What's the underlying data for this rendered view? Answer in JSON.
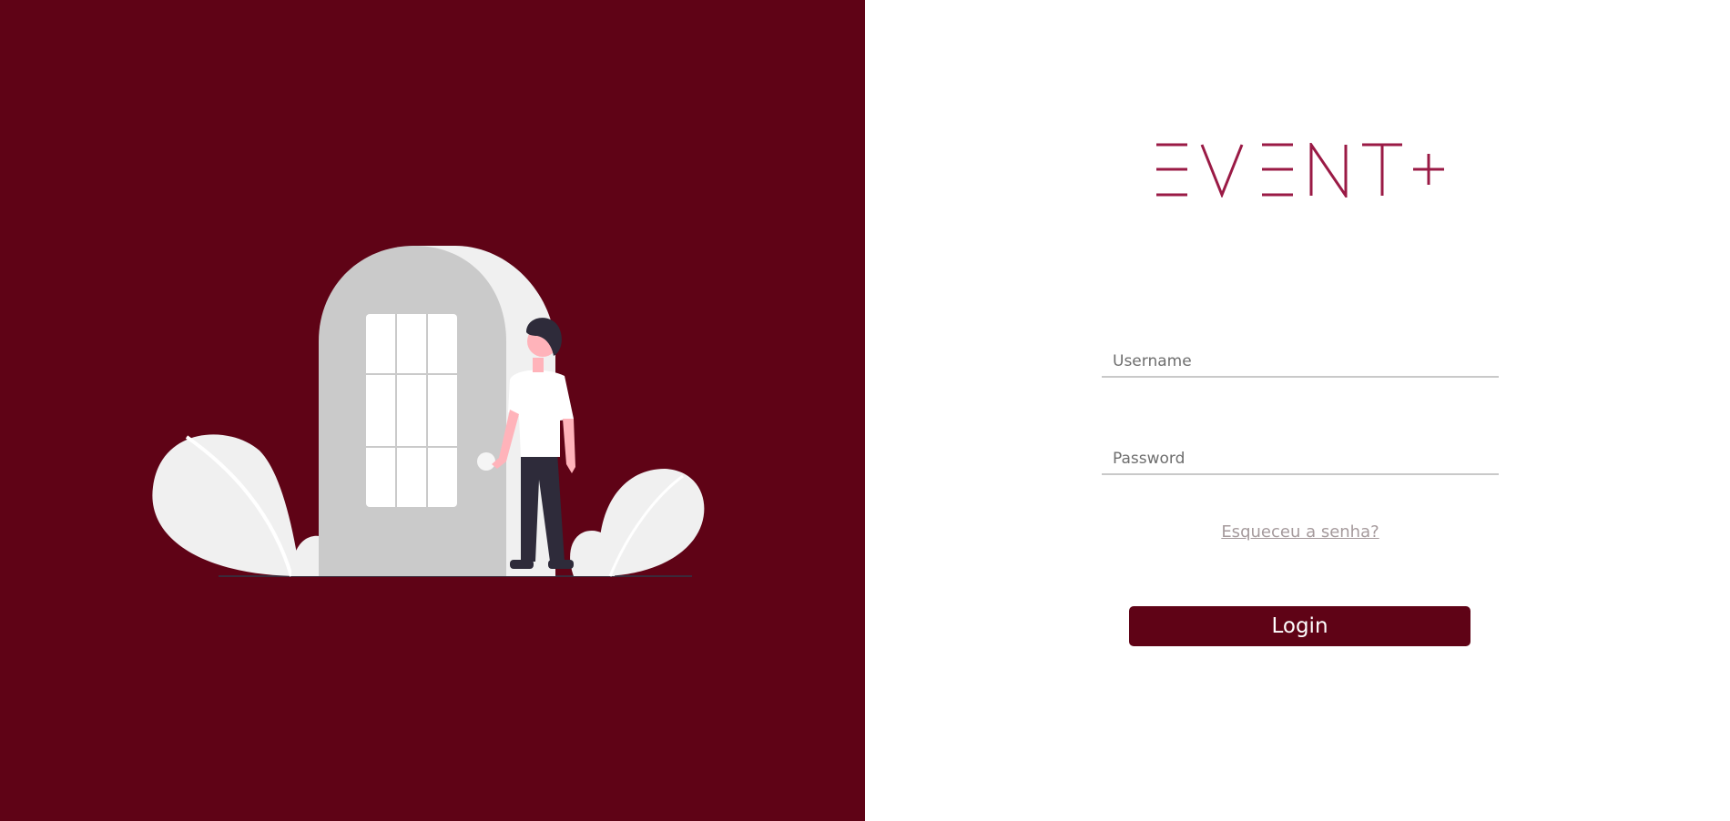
{
  "brand": {
    "logo_text": "EVENT+",
    "color": "#9a1a45"
  },
  "colors": {
    "primary": "#5f0316",
    "background": "#ffffff"
  },
  "illustration": {
    "icon": "person-at-door-illustration"
  },
  "form": {
    "username": {
      "placeholder": "Username",
      "value": ""
    },
    "password": {
      "placeholder": "Password",
      "value": ""
    },
    "forgot_password_label": "Esqueceu a senha?",
    "login_label": "Login"
  }
}
